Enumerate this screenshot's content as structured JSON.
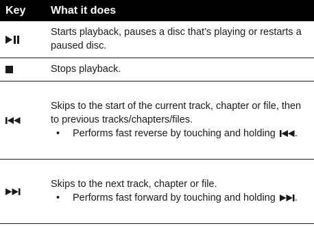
{
  "table": {
    "headers": {
      "key": "Key",
      "desc": "What it does"
    },
    "rows": [
      {
        "key_icon": "play-pause-icon",
        "text": "Starts playback, pauses a disc that’s playing or restarts a paused disc."
      },
      {
        "key_icon": "stop-icon",
        "text": "Stops playback."
      },
      {
        "key_icon": "skip-previous-icon",
        "text": "Skips to the start of the current track, chapter or file, then to previous tracks/chapters/files.",
        "note_prefix": "Performs fast reverse by touching and holding ",
        "note_icon": "skip-previous-icon",
        "note_suffix": "."
      },
      {
        "key_icon": "skip-next-icon",
        "text": "Skips to the next track, chapter or file.",
        "note_prefix": "Performs fast forward by touching and holding ",
        "note_icon": "skip-next-icon",
        "note_suffix": "."
      }
    ]
  }
}
